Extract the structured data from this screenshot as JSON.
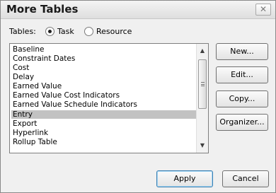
{
  "dialog": {
    "title": "More Tables",
    "close_icon": "close-icon"
  },
  "tables_row": {
    "label": "Tables:",
    "options": [
      {
        "label": "Task",
        "checked": true
      },
      {
        "label": "Resource",
        "checked": false
      }
    ]
  },
  "list": {
    "items": [
      "Baseline",
      "Constraint Dates",
      "Cost",
      "Delay",
      "Earned Value",
      "Earned Value Cost Indicators",
      "Earned Value Schedule Indicators",
      "Entry",
      "Export",
      "Hyperlink",
      "Rollup Table"
    ],
    "selected": "Entry"
  },
  "side_buttons": {
    "new": "New...",
    "edit": "Edit...",
    "copy": "Copy...",
    "organizer": "Organizer..."
  },
  "footer_buttons": {
    "apply": "Apply",
    "cancel": "Cancel"
  },
  "colors": {
    "selection": "#c2c2c2",
    "default_button_border": "#3c7fb1"
  }
}
